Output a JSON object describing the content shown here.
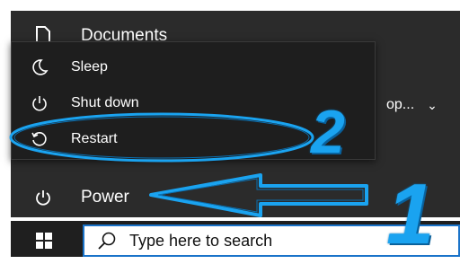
{
  "start_menu": {
    "documents_label": "Documents",
    "power_label": "Power",
    "right_fragment": "op...",
    "right_chevron": "⌄"
  },
  "power_flyout": {
    "items": [
      {
        "label": "Sleep",
        "icon": "moon-icon"
      },
      {
        "label": "Shut down",
        "icon": "power-icon"
      },
      {
        "label": "Restart",
        "icon": "restart-icon"
      }
    ]
  },
  "taskbar": {
    "search_placeholder": "Type here to search"
  },
  "annotations": {
    "step1": "1",
    "step2": "2",
    "accent_color": "#1aa3f0"
  }
}
